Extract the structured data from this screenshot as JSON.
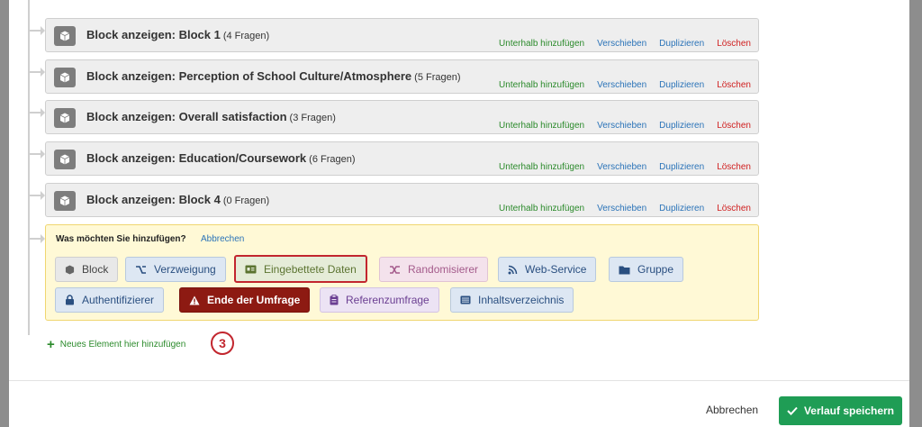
{
  "blocks": [
    {
      "title": "Block anzeigen: Block 1",
      "count": "(4 Fragen)"
    },
    {
      "title": "Block anzeigen: Perception of School Culture/Atmosphere",
      "count": "(5 Fragen)"
    },
    {
      "title": "Block anzeigen: Overall satisfaction",
      "count": "(3 Fragen)"
    },
    {
      "title": "Block anzeigen: Education/Coursework",
      "count": "(6 Fragen)"
    },
    {
      "title": "Block anzeigen: Block 4",
      "count": "(0 Fragen)"
    }
  ],
  "block_actions": {
    "add_below": "Unterhalb hinzufügen",
    "move": "Verschieben",
    "duplicate": "Duplizieren",
    "delete": "Löschen"
  },
  "picker": {
    "question": "Was möchten Sie hinzufügen?",
    "cancel": "Abbrechen",
    "options": {
      "block": "Block",
      "branch": "Verzweigung",
      "embedded_data": "Eingebettete Daten",
      "randomizer": "Randomisierer",
      "web_service": "Web-Service",
      "group": "Gruppe",
      "authenticator": "Authentifizierer",
      "end_of_survey": "Ende der Umfrage",
      "reference_survey": "Referenzumfrage",
      "table_of_contents": "Inhaltsverzeichnis"
    }
  },
  "add_new_element": "Neues Element hier hinzufügen",
  "step_number": "3",
  "footer": {
    "cancel": "Abbrechen",
    "save": "Verlauf speichern"
  },
  "colors": {
    "accent_green": "#1f9d55",
    "highlight_red": "#c2262e",
    "end_survey_bg": "#8d1a12"
  }
}
